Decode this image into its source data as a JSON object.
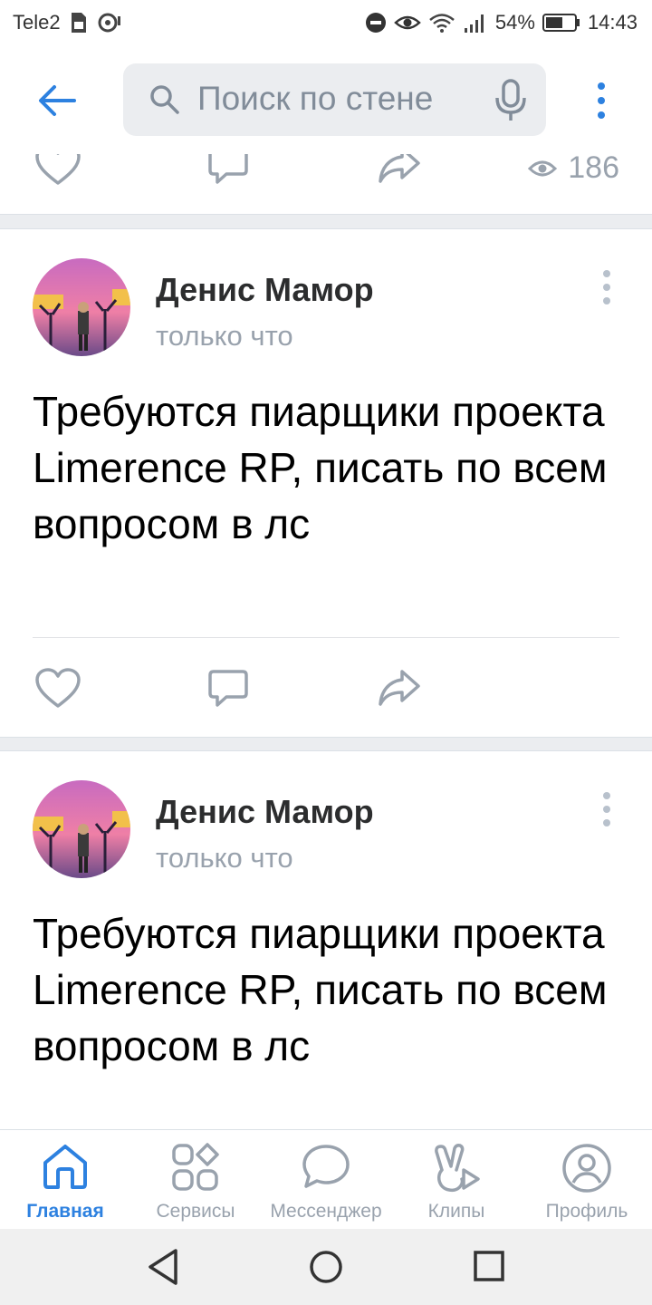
{
  "status_bar": {
    "carrier": "Tele2",
    "battery": "54%",
    "time": "14:43"
  },
  "header": {
    "search_placeholder": "Поиск по стене",
    "icons": [
      "back-arrow-icon",
      "search-icon",
      "microphone-icon",
      "more-vertical-icon"
    ]
  },
  "previous_post": {
    "views": "186"
  },
  "posts": [
    {
      "author": "Денис Мамор",
      "time": "только что",
      "text": "Требуются пиарщики проекта Limerence RP, писать по всем вопросом в лс"
    },
    {
      "author": "Денис Мамор",
      "time": "только что",
      "text": "Требуются пиарщики проекта Limerence RP, писать по всем вопросом в лс"
    }
  ],
  "tabs": [
    {
      "label": "Главная",
      "icon": "home-icon",
      "active": true
    },
    {
      "label": "Сервисы",
      "icon": "services-icon",
      "active": false
    },
    {
      "label": "Мессенджер",
      "icon": "chat-bubble-icon",
      "active": false
    },
    {
      "label": "Клипы",
      "icon": "clips-icon",
      "active": false
    },
    {
      "label": "Профиль",
      "icon": "profile-icon",
      "active": false
    }
  ],
  "colors": {
    "accent": "#2d81e0",
    "secondary_text": "#99a2ad",
    "background": "#ebedf0"
  }
}
